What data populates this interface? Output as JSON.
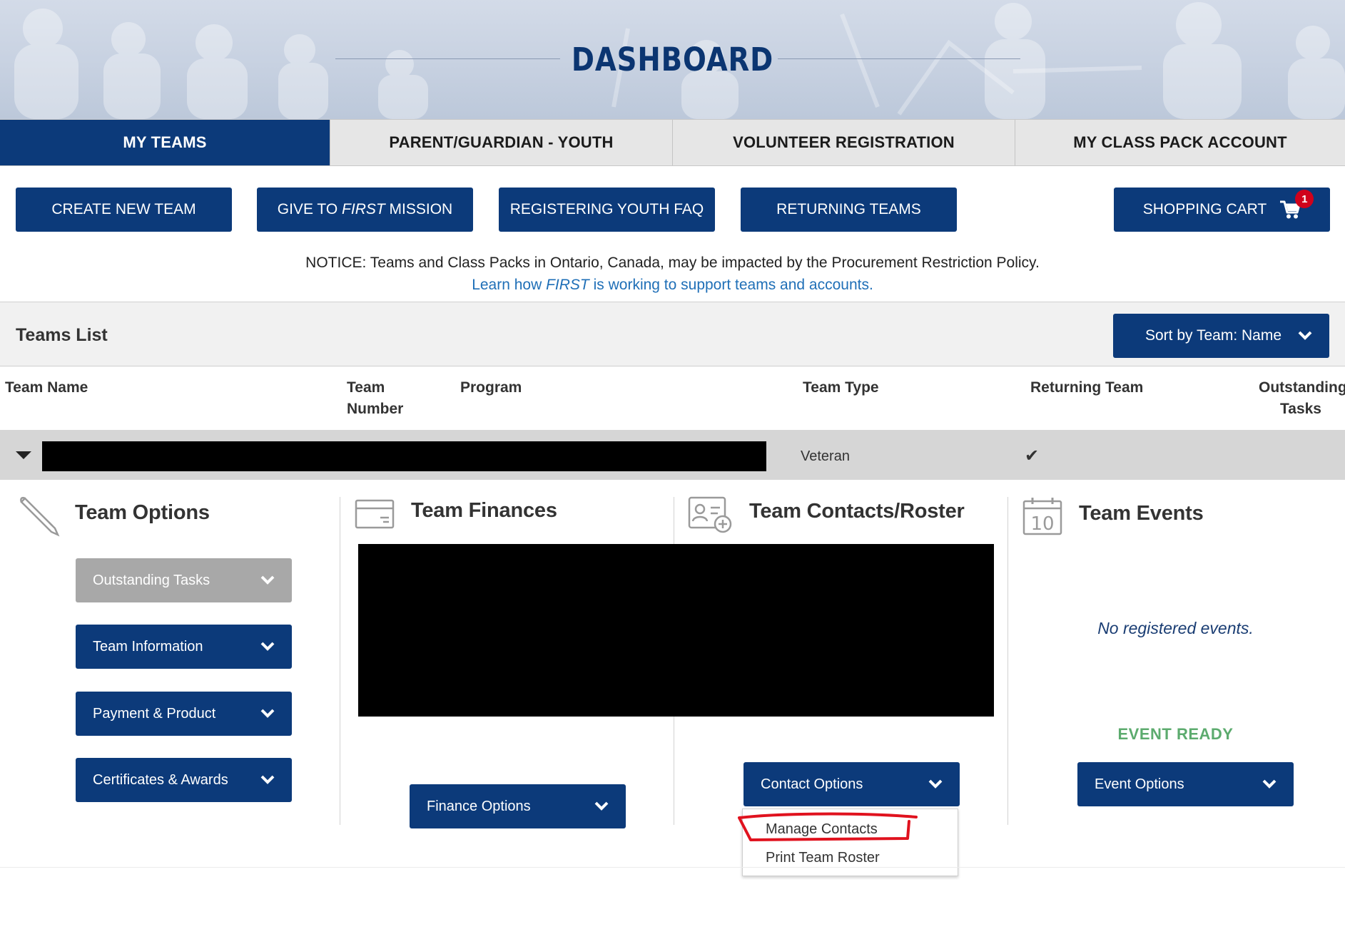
{
  "header": {
    "title": "DASHBOARD"
  },
  "tabs": [
    {
      "label": "MY TEAMS",
      "active": true
    },
    {
      "label": "PARENT/GUARDIAN - YOUTH",
      "active": false
    },
    {
      "label": "VOLUNTEER REGISTRATION",
      "active": false
    },
    {
      "label": "MY CLASS PACK ACCOUNT",
      "active": false
    }
  ],
  "actions": {
    "create_team": "CREATE NEW TEAM",
    "give_prefix": "GIVE TO ",
    "give_first": "FIRST",
    "give_suffix": " MISSION",
    "youth_faq": "REGISTERING YOUTH FAQ",
    "returning": "RETURNING TEAMS",
    "cart": "SHOPPING CART",
    "cart_count": "1"
  },
  "notice": {
    "text": "NOTICE: Teams and Class Packs in Ontario, Canada, may be impacted by the Procurement Restriction Policy.",
    "link_prefix": "Learn how ",
    "link_first": "FIRST",
    "link_suffix": " is working to support teams and accounts."
  },
  "teams_list": {
    "title": "Teams List",
    "sort_label": "Sort by Team: Name",
    "columns": {
      "team_name": "Team Name",
      "team_number_1": "Team",
      "team_number_2": "Number",
      "program": "Program",
      "team_type": "Team Type",
      "returning": "Returning Team",
      "outstanding_1": "Outstanding",
      "outstanding_2": "Tasks"
    },
    "row": {
      "team_type": "Veteran",
      "returning_check": "✔"
    }
  },
  "panels": {
    "options": {
      "title": "Team Options",
      "buttons": [
        "Outstanding Tasks",
        "Team Information",
        "Payment & Product",
        "Certificates & Awards"
      ]
    },
    "finances": {
      "title": "Team Finances",
      "button": "Finance Options"
    },
    "contacts": {
      "title": "Team Contacts/Roster",
      "button": "Contact Options",
      "menu": [
        "Manage Contacts",
        "Print Team Roster"
      ]
    },
    "events": {
      "title": "Team Events",
      "calendar_day": "10",
      "empty": "No registered events.",
      "status": "EVENT READY",
      "button": "Event Options"
    }
  },
  "colors": {
    "primary": "#0c3a7a",
    "link": "#1f6fb7",
    "success": "#5cab6e",
    "badge": "#d0021b",
    "disabled": "#a8a8a8"
  }
}
